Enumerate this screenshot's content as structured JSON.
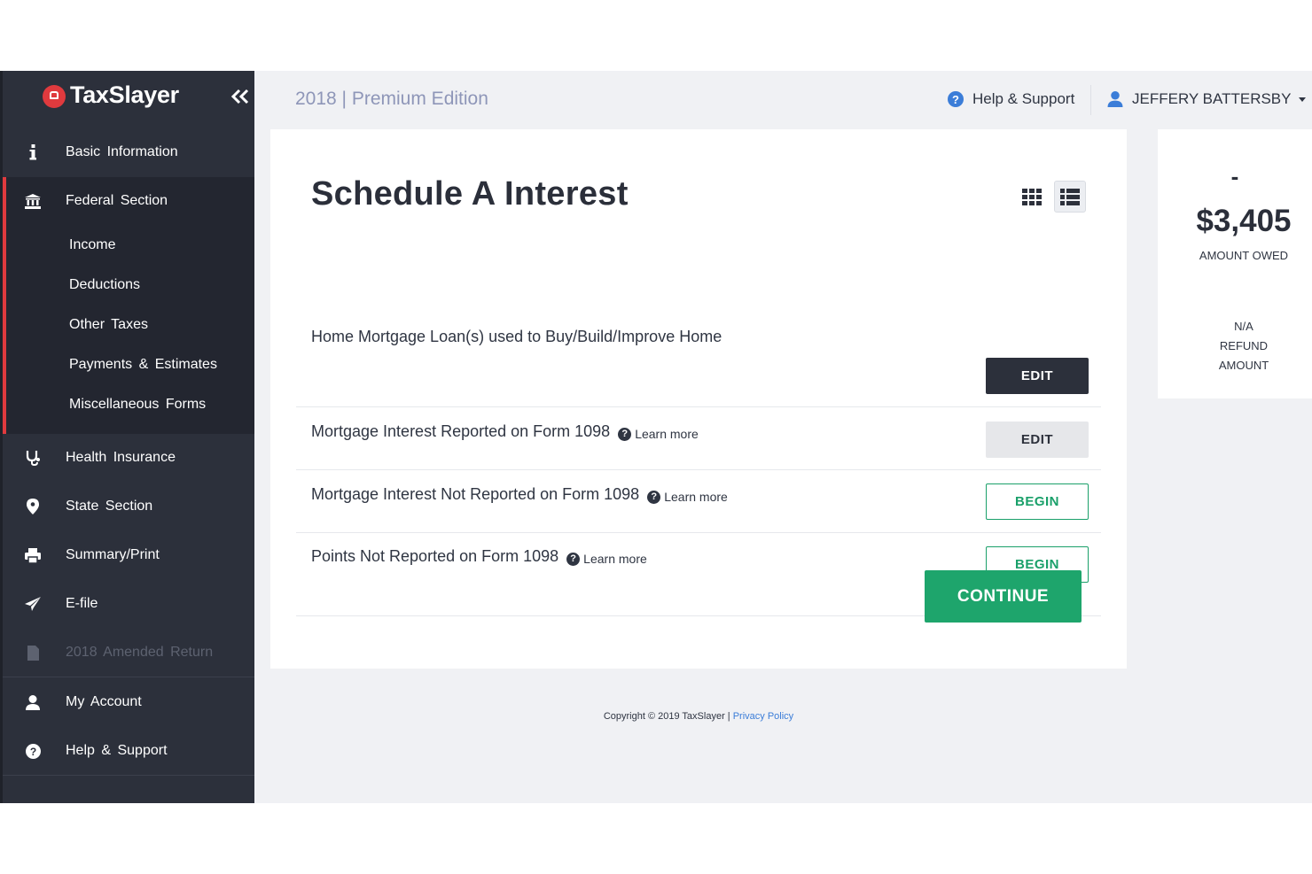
{
  "brand": {
    "name": "TaxSlayer"
  },
  "sidebar": {
    "items": [
      {
        "label": "Basic Information",
        "icon": "info-icon"
      },
      {
        "label": "Federal Section",
        "icon": "bank-icon"
      },
      {
        "label": "Health Insurance",
        "icon": "stethoscope-icon"
      },
      {
        "label": "State Section",
        "icon": "map-pin-icon"
      },
      {
        "label": "Summary/Print",
        "icon": "printer-icon"
      },
      {
        "label": "E-file",
        "icon": "paper-plane-icon"
      },
      {
        "label": "2018 Amended Return",
        "icon": "document-icon"
      },
      {
        "label": "My Account",
        "icon": "user-icon"
      },
      {
        "label": "Help & Support",
        "icon": "question-icon"
      }
    ],
    "federal_sub": [
      "Income",
      "Deductions",
      "Other Taxes",
      "Payments & Estimates",
      "Miscellaneous Forms"
    ]
  },
  "header": {
    "edition": "2018 | Premium Edition",
    "help": "Help & Support",
    "user": "JEFFERY BATTERSBY"
  },
  "main": {
    "title": "Schedule A Interest",
    "learn_more": "Learn more",
    "rows": [
      {
        "label": "Home Mortgage Loan(s) used to Buy/Build/Improve Home",
        "action": "EDIT"
      },
      {
        "label": "Mortgage Interest Reported on Form 1098",
        "action": "EDIT"
      },
      {
        "label": "Mortgage Interest Not Reported on Form 1098",
        "action": "BEGIN"
      },
      {
        "label": "Points Not Reported on Form 1098",
        "action": "BEGIN"
      }
    ],
    "continue": "CONTINUE"
  },
  "summary": {
    "dash": "-",
    "amount": "$3,405",
    "amount_label": "AMOUNT OWED",
    "refund_value": "N/A",
    "refund_label_1": "REFUND",
    "refund_label_2": "AMOUNT"
  },
  "footer": {
    "copyright": "Copyright © 2019 TaxSlayer | ",
    "privacy": "Privacy Policy"
  },
  "colors": {
    "accent_green": "#1ea56c",
    "sidebar_bg": "#2c303b",
    "brand_red": "#e03a3e",
    "link_blue": "#3b7dd8"
  }
}
